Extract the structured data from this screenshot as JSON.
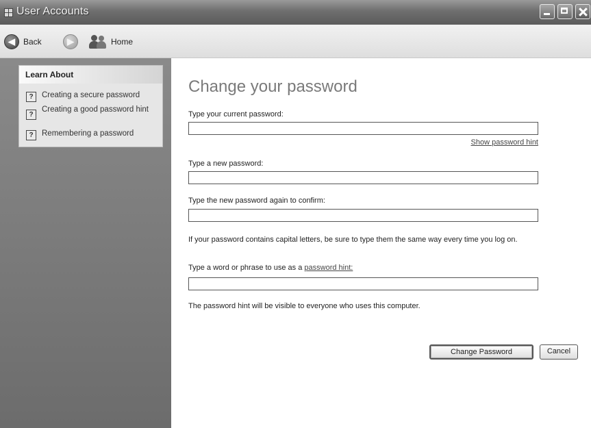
{
  "window": {
    "title": "User Accounts"
  },
  "toolbar": {
    "back_label": "Back",
    "home_label": "Home"
  },
  "sidebar": {
    "learn_about_title": "Learn About",
    "items": [
      {
        "label": "Creating a secure password"
      },
      {
        "label": "Creating a good password hint"
      },
      {
        "label": "Remembering a password"
      }
    ]
  },
  "main": {
    "heading": "Change your password",
    "current_password_label": "Type your current password:",
    "current_password_value": "",
    "show_hint_link": "Show password hint",
    "new_password_label": "Type a new password:",
    "new_password_value": "",
    "confirm_password_label": "Type the new password again to confirm:",
    "confirm_password_value": "",
    "capital_letters_note": "If your password contains capital letters, be sure to type them the same way every time you log on.",
    "hint_label_prefix": "Type a word or phrase to use as a",
    "hint_label_link": "password hint:",
    "hint_value": "",
    "hint_visibility_note": "The password hint will be visible to everyone who uses this computer."
  },
  "buttons": {
    "change_password_label": "Change Password",
    "cancel_label": "Cancel"
  },
  "icons": {
    "app": "user-accounts-icon",
    "back": "back-arrow-icon",
    "forward": "forward-arrow-icon",
    "home": "users-home-icon",
    "help": "help-question-icon"
  }
}
